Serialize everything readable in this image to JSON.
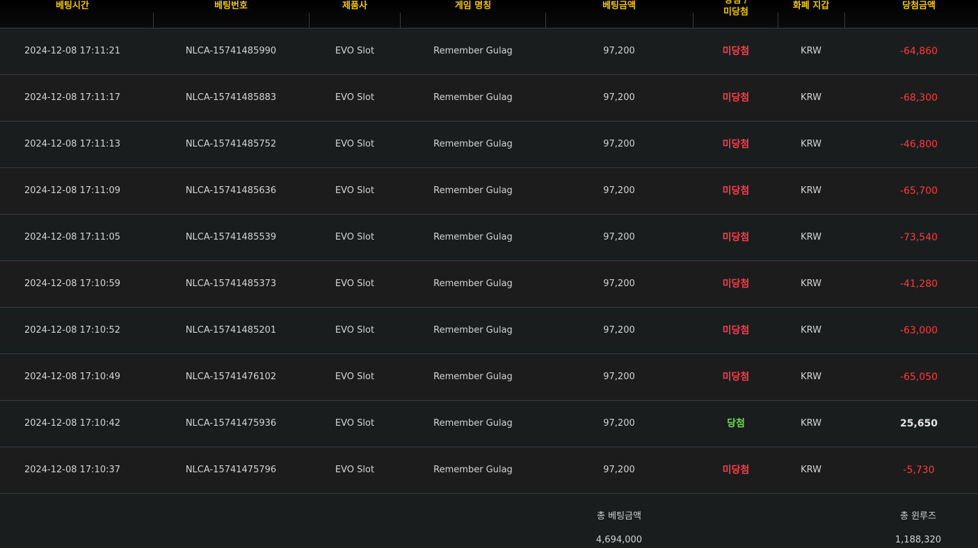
{
  "header": {
    "bet_time": "베팅시간",
    "bet_number": "베팅번호",
    "provider": "제품사",
    "game_name": "게임 명칭",
    "bet_amount": "베팅금액",
    "result_line1": "당첨 /",
    "result_line2": "미당첨",
    "currency": "화폐 지갑",
    "win_amount": "당첨금액"
  },
  "rows": [
    {
      "time": "2024-12-08 17:11:21",
      "number": "NLCA-15741485990",
      "provider": "EVO Slot",
      "game": "Remember Gulag",
      "bet": "97,200",
      "result": "미당첨",
      "currency": "KRW",
      "amount": "-64,860"
    },
    {
      "time": "2024-12-08 17:11:17",
      "number": "NLCA-15741485883",
      "provider": "EVO Slot",
      "game": "Remember Gulag",
      "bet": "97,200",
      "result": "미당첨",
      "currency": "KRW",
      "amount": "-68,300"
    },
    {
      "time": "2024-12-08 17:11:13",
      "number": "NLCA-15741485752",
      "provider": "EVO Slot",
      "game": "Remember Gulag",
      "bet": "97,200",
      "result": "미당첨",
      "currency": "KRW",
      "amount": "-46,800"
    },
    {
      "time": "2024-12-08 17:11:09",
      "number": "NLCA-15741485636",
      "provider": "EVO Slot",
      "game": "Remember Gulag",
      "bet": "97,200",
      "result": "미당첨",
      "currency": "KRW",
      "amount": "-65,700"
    },
    {
      "time": "2024-12-08 17:11:05",
      "number": "NLCA-15741485539",
      "provider": "EVO Slot",
      "game": "Remember Gulag",
      "bet": "97,200",
      "result": "미당첨",
      "currency": "KRW",
      "amount": "-73,540"
    },
    {
      "time": "2024-12-08 17:10:59",
      "number": "NLCA-15741485373",
      "provider": "EVO Slot",
      "game": "Remember Gulag",
      "bet": "97,200",
      "result": "미당첨",
      "currency": "KRW",
      "amount": "-41,280"
    },
    {
      "time": "2024-12-08 17:10:52",
      "number": "NLCA-15741485201",
      "provider": "EVO Slot",
      "game": "Remember Gulag",
      "bet": "97,200",
      "result": "미당첨",
      "currency": "KRW",
      "amount": "-63,000"
    },
    {
      "time": "2024-12-08 17:10:49",
      "number": "NLCA-15741476102",
      "provider": "EVO Slot",
      "game": "Remember Gulag",
      "bet": "97,200",
      "result": "미당첨",
      "currency": "KRW",
      "amount": "-65,050"
    },
    {
      "time": "2024-12-08 17:10:42",
      "number": "NLCA-15741475936",
      "provider": "EVO Slot",
      "game": "Remember Gulag",
      "bet": "97,200",
      "result": "당첨",
      "currency": "KRW",
      "amount": "25,650"
    },
    {
      "time": "2024-12-08 17:10:37",
      "number": "NLCA-15741475796",
      "provider": "EVO Slot",
      "game": "Remember Gulag",
      "bet": "97,200",
      "result": "미당첨",
      "currency": "KRW",
      "amount": "-5,730"
    }
  ],
  "footer": {
    "total_bet_label": "총 베팅금액",
    "total_bet_value": "4,694,000",
    "total_winloss_label": "총 윈루즈",
    "total_winloss_value": "1,188,320"
  },
  "colors": {
    "header_text": "#f5c800",
    "lose": "#ff3b4b",
    "win": "#6bdc4a",
    "negative_amount": "#ff3b3b"
  }
}
